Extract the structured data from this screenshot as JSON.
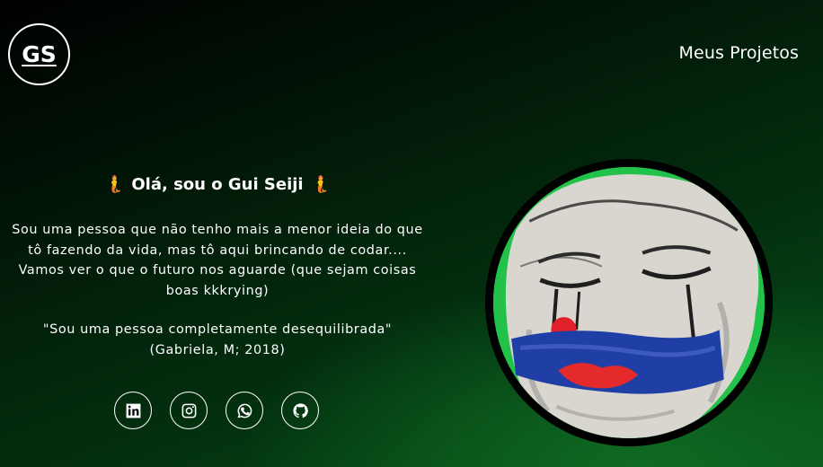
{
  "header": {
    "logo_text": "GS",
    "nav_label": "Meus Projetos"
  },
  "intro": {
    "emoji_left": "🧜",
    "title": "Olá, sou o Gui Seiji",
    "emoji_right": "🧜",
    "bio": "Sou uma pessoa que não tenho mais a menor ideia do que tô fazendo da vida, mas tô aqui brincando de codar.... Vamos ver o que o futuro nos aguarde (que sejam coisas boas kkkrying)",
    "quote": "\"Sou uma pessoa completamente desequilibrada\" (Gabriela, M; 2018)"
  },
  "socials": [
    {
      "name": "linkedin-icon"
    },
    {
      "name": "instagram-icon"
    },
    {
      "name": "whatsapp-icon"
    },
    {
      "name": "github-icon"
    }
  ],
  "colors": {
    "background_dark": "#000000",
    "background_green": "#065218",
    "portrait_bg": "#1fc24d",
    "text": "#ffffff"
  }
}
